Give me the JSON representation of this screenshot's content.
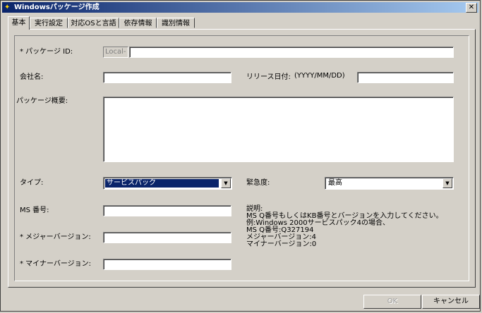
{
  "window": {
    "title": "Windowsパッケージ作成",
    "close_glyph": "✕",
    "icon": "app-icon"
  },
  "tabs": [
    {
      "label": "基本",
      "active": true
    },
    {
      "label": "実行設定",
      "active": false
    },
    {
      "label": "対応OSと言語",
      "active": false
    },
    {
      "label": "依存情報",
      "active": false
    },
    {
      "label": "識別情報",
      "active": false
    }
  ],
  "form": {
    "package_id": {
      "label": "* パッケージ ID:",
      "prefix": "Local-",
      "value": ""
    },
    "company": {
      "label": "会社名:",
      "value": ""
    },
    "release_date": {
      "label": "リリース日付:",
      "format": "(YYYY/MM/DD)",
      "value": ""
    },
    "summary": {
      "label": "パッケージ概要:",
      "value": ""
    },
    "type": {
      "label": "タイプ:",
      "value": "サービスパック"
    },
    "urgency": {
      "label": "緊急度:",
      "value": "最高"
    },
    "ms_number": {
      "label": "MS 番号:",
      "value": ""
    },
    "major_version": {
      "label": "* メジャーバージョン:",
      "value": ""
    },
    "minor_version": {
      "label": "* マイナーバージョン:",
      "value": ""
    }
  },
  "help": {
    "title": "説明:",
    "lines": [
      "MS Q番号もしくはKB番号とバージョンを入力してください。",
      "例:Windows 2000サービスパック4の場合、",
      "MS Q番号:Q327194",
      "メジャーバージョン:4",
      "マイナーバージョン:0"
    ]
  },
  "buttons": {
    "ok": "OK",
    "cancel": "キャンセル"
  }
}
